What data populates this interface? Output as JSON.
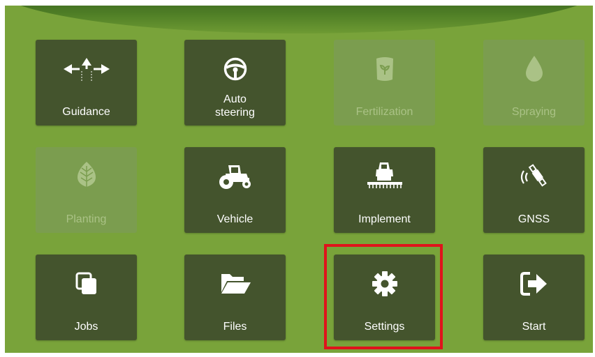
{
  "tiles": {
    "guidance": {
      "label": "Guidance",
      "icon": "arrows-icon",
      "enabled": true
    },
    "auto_steering": {
      "label_line1": "Auto",
      "label_line2": "steering",
      "icon": "steering-wheel-icon",
      "enabled": true
    },
    "fertilization": {
      "label": "Fertilization",
      "icon": "fertilizer-bag-icon",
      "enabled": false
    },
    "spraying": {
      "label": "Spraying",
      "icon": "droplet-icon",
      "enabled": false
    },
    "planting": {
      "label": "Planting",
      "icon": "leaf-icon",
      "enabled": false
    },
    "vehicle": {
      "label": "Vehicle",
      "icon": "tractor-icon",
      "enabled": true
    },
    "implement": {
      "label": "Implement",
      "icon": "implement-icon",
      "enabled": true
    },
    "gnss": {
      "label": "GNSS",
      "icon": "satellite-icon",
      "enabled": true
    },
    "jobs": {
      "label": "Jobs",
      "icon": "copy-icon",
      "enabled": true
    },
    "files": {
      "label": "Files",
      "icon": "folder-open-icon",
      "enabled": true
    },
    "settings": {
      "label": "Settings",
      "icon": "gear-icon",
      "enabled": true,
      "highlighted": true
    },
    "start": {
      "label": "Start",
      "icon": "exit-icon",
      "enabled": true
    }
  },
  "colors": {
    "background": "#79a33a",
    "tile": "#44542d",
    "tile_disabled": "#7b9d4f",
    "highlight": "#e0131b"
  }
}
